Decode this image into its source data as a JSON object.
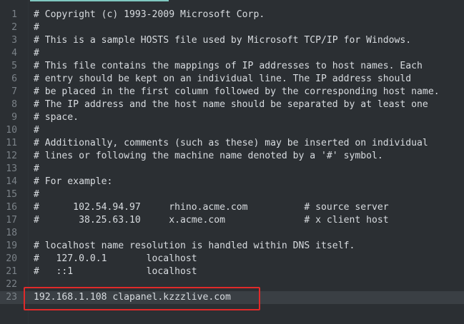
{
  "editor": {
    "accent_color": "#7fc8c0",
    "highlight_color": "#e02a2a",
    "current_line": 23
  },
  "lines": [
    {
      "num": "1",
      "text": "# Copyright (c) 1993-2009 Microsoft Corp."
    },
    {
      "num": "2",
      "text": "#"
    },
    {
      "num": "3",
      "text": "# This is a sample HOSTS file used by Microsoft TCP/IP for Windows."
    },
    {
      "num": "4",
      "text": "#"
    },
    {
      "num": "5",
      "text": "# This file contains the mappings of IP addresses to host names. Each"
    },
    {
      "num": "6",
      "text": "# entry should be kept on an individual line. The IP address should"
    },
    {
      "num": "7",
      "text": "# be placed in the first column followed by the corresponding host name."
    },
    {
      "num": "8",
      "text": "# The IP address and the host name should be separated by at least one"
    },
    {
      "num": "9",
      "text": "# space."
    },
    {
      "num": "10",
      "text": "#"
    },
    {
      "num": "11",
      "text": "# Additionally, comments (such as these) may be inserted on individual"
    },
    {
      "num": "12",
      "text": "# lines or following the machine name denoted by a '#' symbol."
    },
    {
      "num": "13",
      "text": "#"
    },
    {
      "num": "14",
      "text": "# For example:"
    },
    {
      "num": "15",
      "text": "#"
    },
    {
      "num": "16",
      "text": "#      102.54.94.97     rhino.acme.com          # source server"
    },
    {
      "num": "17",
      "text": "#       38.25.63.10     x.acme.com              # x client host"
    },
    {
      "num": "18",
      "text": ""
    },
    {
      "num": "19",
      "text": "# localhost name resolution is handled within DNS itself."
    },
    {
      "num": "20",
      "text": "#   127.0.0.1       localhost"
    },
    {
      "num": "21",
      "text": "#   ::1             localhost"
    },
    {
      "num": "22",
      "text": ""
    },
    {
      "num": "23",
      "text": "192.168.1.108 clapanel.kzzzlive.com"
    }
  ]
}
